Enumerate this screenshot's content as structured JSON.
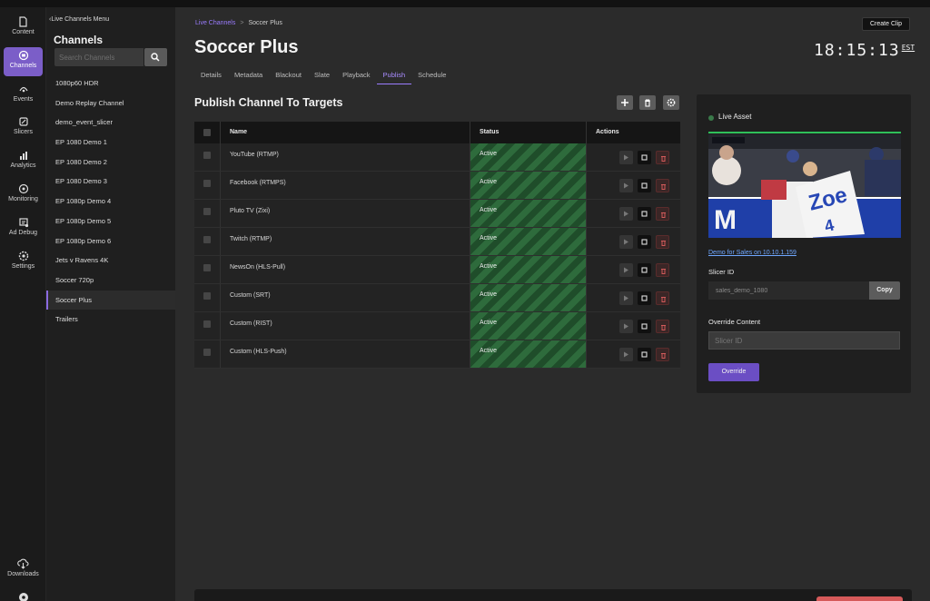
{
  "rail": {
    "items": [
      {
        "label": "Content",
        "icon": "document-icon"
      },
      {
        "label": "Channels",
        "icon": "channels-icon"
      },
      {
        "label": "Events",
        "icon": "events-icon"
      },
      {
        "label": "Slicers",
        "icon": "slicers-icon"
      },
      {
        "label": "Analytics",
        "icon": "analytics-icon"
      },
      {
        "label": "Monitoring",
        "icon": "monitoring-icon"
      },
      {
        "label": "Ad Debug",
        "icon": "ad-debug-icon"
      },
      {
        "label": "Settings",
        "icon": "gear-icon"
      }
    ],
    "downloads": "Downloads"
  },
  "sidebar": {
    "back": "Live Channels Menu",
    "title": "Channels",
    "search_placeholder": "Search Channels",
    "channels": [
      "1080p60 HDR",
      "Demo Replay Channel",
      "demo_event_slicer",
      "EP 1080 Demo 1",
      "EP 1080 Demo 2",
      "EP 1080 Demo 3",
      "EP 1080p Demo 4",
      "EP 1080p Demo 5",
      "EP 1080p Demo 6",
      "Jets v Ravens 4K",
      "Soccer 720p",
      "Soccer Plus",
      "Trailers"
    ],
    "active_channel": "Soccer Plus"
  },
  "header": {
    "breadcrumb_root": "Live Channels",
    "breadcrumb_sep": ">",
    "breadcrumb_current": "Soccer Plus",
    "title": "Soccer Plus",
    "create_clip": "Create Clip",
    "clock": "18:15:13",
    "timezone": "EST"
  },
  "tabs": [
    "Details",
    "Metadata",
    "Blackout",
    "Slate",
    "Playback",
    "Publish",
    "Schedule"
  ],
  "active_tab": "Publish",
  "publish": {
    "title": "Publish Channel To Targets",
    "columns": {
      "name": "Name",
      "status": "Status",
      "actions": "Actions"
    },
    "rows": [
      {
        "name": "YouTube (RTMP)",
        "status": "Active"
      },
      {
        "name": "Facebook (RTMPS)",
        "status": "Active"
      },
      {
        "name": "Pluto TV (Zixi)",
        "status": "Active"
      },
      {
        "name": "Twitch (RTMP)",
        "status": "Active"
      },
      {
        "name": "NewsOn (HLS-Pull)",
        "status": "Active"
      },
      {
        "name": "Custom (SRT)",
        "status": "Active"
      },
      {
        "name": "Custom (RIST)",
        "status": "Active"
      },
      {
        "name": "Custom (HLS-Push)",
        "status": "Active"
      }
    ]
  },
  "panel": {
    "live_label": "Live Asset",
    "asset_link": "Demo for Sales on 10.10.1.159",
    "slicer_label": "Slicer ID",
    "slicer_value": "sales_demo_1080",
    "copy": "Copy",
    "override_label": "Override Content",
    "override_placeholder": "Slicer ID",
    "override_button": "Override"
  },
  "colors": {
    "accent": "#7b5ec8",
    "active_status": "#2e6b3c",
    "link": "#6fa7ff"
  }
}
